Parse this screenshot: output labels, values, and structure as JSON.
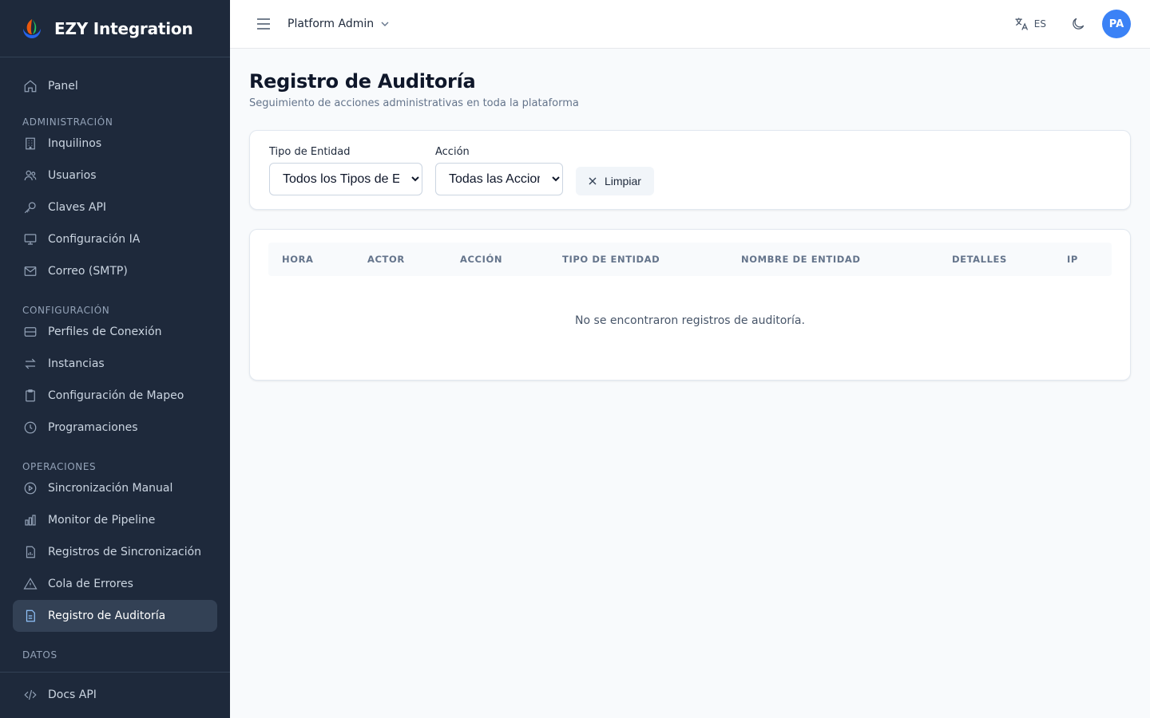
{
  "brand": {
    "name": "EZY Integration"
  },
  "sidebar": {
    "top_items": [
      {
        "label": "Panel",
        "icon": "home-icon"
      }
    ],
    "sections": [
      {
        "title": "ADMINISTRACIÓN",
        "items": [
          {
            "label": "Inquilinos",
            "icon": "building-icon"
          },
          {
            "label": "Usuarios",
            "icon": "users-icon"
          },
          {
            "label": "Claves API",
            "icon": "key-icon"
          },
          {
            "label": "Configuración IA",
            "icon": "monitor-icon"
          },
          {
            "label": "Correo (SMTP)",
            "icon": "mail-icon"
          }
        ]
      },
      {
        "title": "CONFIGURACIÓN",
        "items": [
          {
            "label": "Perfiles de Conexión",
            "icon": "server-icon"
          },
          {
            "label": "Instancias",
            "icon": "arrows-icon"
          },
          {
            "label": "Configuración de Mapeo",
            "icon": "clipboard-icon"
          },
          {
            "label": "Programaciones",
            "icon": "clock-icon"
          }
        ]
      },
      {
        "title": "OPERACIONES",
        "items": [
          {
            "label": "Sincronización Manual",
            "icon": "play-circle-icon"
          },
          {
            "label": "Monitor de Pipeline",
            "icon": "bar-chart-icon"
          },
          {
            "label": "Registros de Sincronización",
            "icon": "file-chart-icon"
          },
          {
            "label": "Cola de Errores",
            "icon": "warning-icon"
          },
          {
            "label": "Registro de Auditoría",
            "icon": "document-icon",
            "active": true
          }
        ]
      },
      {
        "title": "DATOS",
        "items": []
      }
    ],
    "footer_item": {
      "label": "Docs API",
      "icon": "code-icon"
    }
  },
  "topbar": {
    "tenant": "Platform Admin",
    "language": "ES",
    "avatar_initials": "PA"
  },
  "page": {
    "title": "Registro de Auditoría",
    "subtitle": "Seguimiento de acciones administrativas en toda la plataforma"
  },
  "filters": {
    "entity_type_label": "Tipo de Entidad",
    "entity_type_value": "Todos los Tipos de Entidad",
    "action_label": "Acción",
    "action_value": "Todas las Acciones",
    "clear_label": "Limpiar"
  },
  "table": {
    "columns": [
      "HORA",
      "ACTOR",
      "ACCIÓN",
      "TIPO DE ENTIDAD",
      "NOMBRE DE ENTIDAD",
      "DETALLES",
      "IP"
    ],
    "rows": [],
    "empty_message": "No se encontraron registros de auditoría."
  },
  "colors": {
    "sidebar_bg": "#1e293b",
    "active_item_bg": "#334155",
    "accent": "#3b82f6",
    "page_bg": "#f8fafc"
  }
}
